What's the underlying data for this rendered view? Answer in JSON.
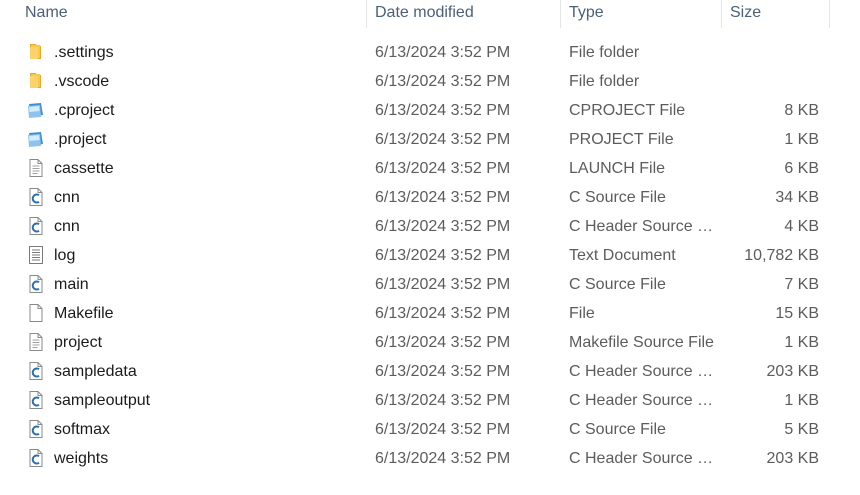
{
  "columns": {
    "name": "Name",
    "date": "Date modified",
    "type": "Type",
    "size": "Size"
  },
  "files": [
    {
      "name": ".settings",
      "date": "6/13/2024 3:52 PM",
      "type": "File folder",
      "size": "",
      "icon": "folder-icon"
    },
    {
      "name": ".vscode",
      "date": "6/13/2024 3:52 PM",
      "type": "File folder",
      "size": "",
      "icon": "folder-icon"
    },
    {
      "name": ".cproject",
      "date": "6/13/2024 3:52 PM",
      "type": "CPROJECT File",
      "size": "8 KB",
      "icon": "project-file-icon"
    },
    {
      "name": ".project",
      "date": "6/13/2024 3:52 PM",
      "type": "PROJECT File",
      "size": "1 KB",
      "icon": "project-file-icon"
    },
    {
      "name": "cassette",
      "date": "6/13/2024 3:52 PM",
      "type": "LAUNCH File",
      "size": "6 KB",
      "icon": "text-file-icon"
    },
    {
      "name": "cnn",
      "date": "6/13/2024 3:52 PM",
      "type": "C Source File",
      "size": "34 KB",
      "icon": "c-file-icon"
    },
    {
      "name": "cnn",
      "date": "6/13/2024 3:52 PM",
      "type": "C Header Source F...",
      "size": "4 KB",
      "icon": "c-file-icon"
    },
    {
      "name": "log",
      "date": "6/13/2024 3:52 PM",
      "type": "Text Document",
      "size": "10,782 KB",
      "icon": "text-document-icon"
    },
    {
      "name": "main",
      "date": "6/13/2024 3:52 PM",
      "type": "C Source File",
      "size": "7 KB",
      "icon": "c-file-icon"
    },
    {
      "name": "Makefile",
      "date": "6/13/2024 3:52 PM",
      "type": "File",
      "size": "15 KB",
      "icon": "blank-file-icon"
    },
    {
      "name": "project",
      "date": "6/13/2024 3:52 PM",
      "type": "Makefile Source File",
      "size": "1 KB",
      "icon": "text-file-icon"
    },
    {
      "name": "sampledata",
      "date": "6/13/2024 3:52 PM",
      "type": "C Header Source F...",
      "size": "203 KB",
      "icon": "c-file-icon"
    },
    {
      "name": "sampleoutput",
      "date": "6/13/2024 3:52 PM",
      "type": "C Header Source F...",
      "size": "1 KB",
      "icon": "c-file-icon"
    },
    {
      "name": "softmax",
      "date": "6/13/2024 3:52 PM",
      "type": "C Source File",
      "size": "5 KB",
      "icon": "c-file-icon"
    },
    {
      "name": "weights",
      "date": "6/13/2024 3:52 PM",
      "type": "C Header Source F...",
      "size": "203 KB",
      "icon": "c-file-icon"
    }
  ],
  "colors": {
    "header_text": "#4c607a",
    "folder": "#f8c94c",
    "c_letter": "#2a6fb0",
    "project_blue": "#5aa7e0"
  }
}
